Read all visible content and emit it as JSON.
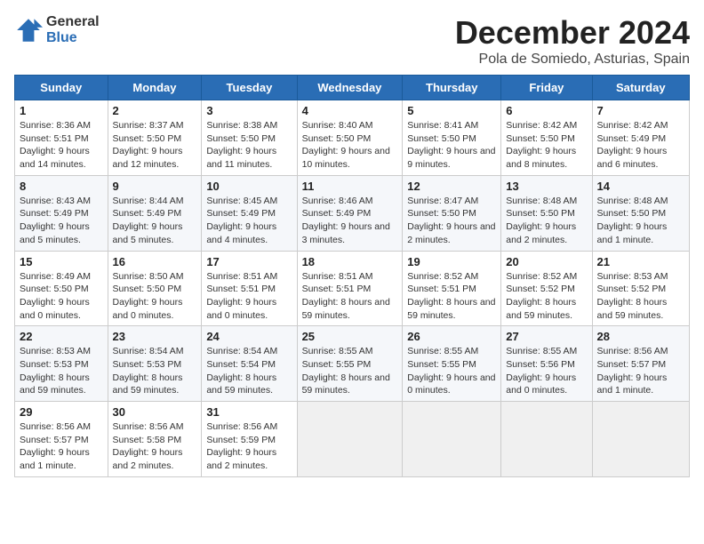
{
  "logo": {
    "line1": "General",
    "line2": "Blue"
  },
  "title": "December 2024",
  "location": "Pola de Somiedo, Asturias, Spain",
  "days_of_week": [
    "Sunday",
    "Monday",
    "Tuesday",
    "Wednesday",
    "Thursday",
    "Friday",
    "Saturday"
  ],
  "weeks": [
    [
      {
        "day": 1,
        "sunrise": "8:36 AM",
        "sunset": "5:51 PM",
        "daylight": "9 hours and 14 minutes."
      },
      {
        "day": 2,
        "sunrise": "8:37 AM",
        "sunset": "5:50 PM",
        "daylight": "9 hours and 12 minutes."
      },
      {
        "day": 3,
        "sunrise": "8:38 AM",
        "sunset": "5:50 PM",
        "daylight": "9 hours and 11 minutes."
      },
      {
        "day": 4,
        "sunrise": "8:40 AM",
        "sunset": "5:50 PM",
        "daylight": "9 hours and 10 minutes."
      },
      {
        "day": 5,
        "sunrise": "8:41 AM",
        "sunset": "5:50 PM",
        "daylight": "9 hours and 9 minutes."
      },
      {
        "day": 6,
        "sunrise": "8:42 AM",
        "sunset": "5:50 PM",
        "daylight": "9 hours and 8 minutes."
      },
      {
        "day": 7,
        "sunrise": "8:42 AM",
        "sunset": "5:49 PM",
        "daylight": "9 hours and 6 minutes."
      }
    ],
    [
      {
        "day": 8,
        "sunrise": "8:43 AM",
        "sunset": "5:49 PM",
        "daylight": "9 hours and 5 minutes."
      },
      {
        "day": 9,
        "sunrise": "8:44 AM",
        "sunset": "5:49 PM",
        "daylight": "9 hours and 5 minutes."
      },
      {
        "day": 10,
        "sunrise": "8:45 AM",
        "sunset": "5:49 PM",
        "daylight": "9 hours and 4 minutes."
      },
      {
        "day": 11,
        "sunrise": "8:46 AM",
        "sunset": "5:49 PM",
        "daylight": "9 hours and 3 minutes."
      },
      {
        "day": 12,
        "sunrise": "8:47 AM",
        "sunset": "5:50 PM",
        "daylight": "9 hours and 2 minutes."
      },
      {
        "day": 13,
        "sunrise": "8:48 AM",
        "sunset": "5:50 PM",
        "daylight": "9 hours and 2 minutes."
      },
      {
        "day": 14,
        "sunrise": "8:48 AM",
        "sunset": "5:50 PM",
        "daylight": "9 hours and 1 minute."
      }
    ],
    [
      {
        "day": 15,
        "sunrise": "8:49 AM",
        "sunset": "5:50 PM",
        "daylight": "9 hours and 0 minutes."
      },
      {
        "day": 16,
        "sunrise": "8:50 AM",
        "sunset": "5:50 PM",
        "daylight": "9 hours and 0 minutes."
      },
      {
        "day": 17,
        "sunrise": "8:51 AM",
        "sunset": "5:51 PM",
        "daylight": "9 hours and 0 minutes."
      },
      {
        "day": 18,
        "sunrise": "8:51 AM",
        "sunset": "5:51 PM",
        "daylight": "8 hours and 59 minutes."
      },
      {
        "day": 19,
        "sunrise": "8:52 AM",
        "sunset": "5:51 PM",
        "daylight": "8 hours and 59 minutes."
      },
      {
        "day": 20,
        "sunrise": "8:52 AM",
        "sunset": "5:52 PM",
        "daylight": "8 hours and 59 minutes."
      },
      {
        "day": 21,
        "sunrise": "8:53 AM",
        "sunset": "5:52 PM",
        "daylight": "8 hours and 59 minutes."
      }
    ],
    [
      {
        "day": 22,
        "sunrise": "8:53 AM",
        "sunset": "5:53 PM",
        "daylight": "8 hours and 59 minutes."
      },
      {
        "day": 23,
        "sunrise": "8:54 AM",
        "sunset": "5:53 PM",
        "daylight": "8 hours and 59 minutes."
      },
      {
        "day": 24,
        "sunrise": "8:54 AM",
        "sunset": "5:54 PM",
        "daylight": "8 hours and 59 minutes."
      },
      {
        "day": 25,
        "sunrise": "8:55 AM",
        "sunset": "5:55 PM",
        "daylight": "8 hours and 59 minutes."
      },
      {
        "day": 26,
        "sunrise": "8:55 AM",
        "sunset": "5:55 PM",
        "daylight": "9 hours and 0 minutes."
      },
      {
        "day": 27,
        "sunrise": "8:55 AM",
        "sunset": "5:56 PM",
        "daylight": "9 hours and 0 minutes."
      },
      {
        "day": 28,
        "sunrise": "8:56 AM",
        "sunset": "5:57 PM",
        "daylight": "9 hours and 1 minute."
      }
    ],
    [
      {
        "day": 29,
        "sunrise": "8:56 AM",
        "sunset": "5:57 PM",
        "daylight": "9 hours and 1 minute."
      },
      {
        "day": 30,
        "sunrise": "8:56 AM",
        "sunset": "5:58 PM",
        "daylight": "9 hours and 2 minutes."
      },
      {
        "day": 31,
        "sunrise": "8:56 AM",
        "sunset": "5:59 PM",
        "daylight": "9 hours and 2 minutes."
      },
      null,
      null,
      null,
      null
    ]
  ]
}
